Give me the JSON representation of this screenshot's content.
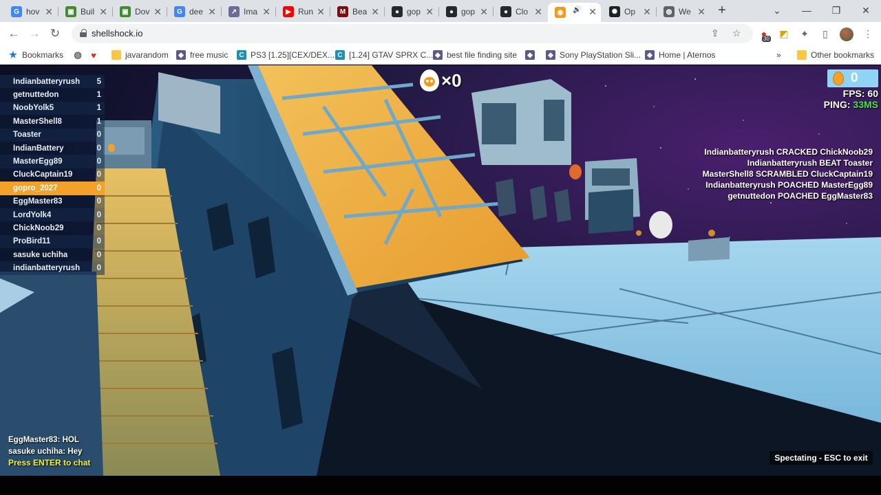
{
  "browser": {
    "tabs": [
      {
        "label": "hov",
        "icon": "google-icon",
        "color": "#ffffff"
      },
      {
        "label": "Buil",
        "icon": "minecraft-icon",
        "color": "#1a1a1a"
      },
      {
        "label": "Dov",
        "icon": "minecraft-icon",
        "color": "#1a1a1a"
      },
      {
        "label": "dee",
        "icon": "google-icon",
        "color": "#ffffff"
      },
      {
        "label": "Ima",
        "icon": "chart-icon",
        "color": "#ffffff"
      },
      {
        "label": "Run",
        "icon": "youtube-icon",
        "color": "#ff0000"
      },
      {
        "label": "Bea",
        "icon": "m-icon",
        "color": "#7a0d0d"
      },
      {
        "label": "gop",
        "icon": "github-icon",
        "color": "#ffffff"
      },
      {
        "label": "gop",
        "icon": "github-icon",
        "color": "#ffffff"
      },
      {
        "label": "Clo",
        "icon": "github-icon",
        "color": "#ffffff"
      },
      {
        "label": "",
        "icon": "shellshock-icon",
        "color": "#ffffff",
        "active": true
      },
      {
        "label": "Op",
        "icon": "openai-icon",
        "color": "#ffffff"
      },
      {
        "label": "We",
        "icon": "globe-icon",
        "color": "#ffffff"
      }
    ],
    "address": "shellshock.io",
    "extension_badge": "30",
    "bookmarks": [
      {
        "label": "Bookmarks",
        "icon": "star-icon"
      },
      {
        "label": "",
        "icon": "globe-icon"
      },
      {
        "label": "",
        "icon": "heart-icon"
      },
      {
        "label": "javarandom",
        "icon": "folder-icon"
      },
      {
        "label": "free music",
        "icon": "site-icon"
      },
      {
        "label": "PS3 [1.25][CEX/DEX...",
        "icon": "c-icon"
      },
      {
        "label": "[1.24] GTAV SPRX C...",
        "icon": "c-icon"
      },
      {
        "label": "best file finding site",
        "icon": "site-icon"
      },
      {
        "label": "",
        "icon": "site-icon"
      },
      {
        "label": "Sony PlayStation Sli...",
        "icon": "site-icon"
      },
      {
        "label": "Home | Aternos",
        "icon": "site-icon"
      }
    ],
    "other_bookmarks": "Other bookmarks",
    "more_bookmarks": "»"
  },
  "game": {
    "scoreboard": [
      {
        "name": "Indianbatteryrush",
        "score": "5"
      },
      {
        "name": "getnuttedon",
        "score": "1"
      },
      {
        "name": "NoobYolk5",
        "score": "1"
      },
      {
        "name": "MasterShell8",
        "score": "1"
      },
      {
        "name": "Toaster",
        "score": "0"
      },
      {
        "name": "IndianBattery",
        "score": "0"
      },
      {
        "name": "MasterEgg89",
        "score": "0"
      },
      {
        "name": "CluckCaptain19",
        "score": "0"
      },
      {
        "name": "gopro_2027",
        "score": "0",
        "me": true
      },
      {
        "name": "EggMaster83",
        "score": "0"
      },
      {
        "name": "LordYolk4",
        "score": "0"
      },
      {
        "name": "ChickNoob29",
        "score": "0"
      },
      {
        "name": "ProBird11",
        "score": "0"
      },
      {
        "name": "sasuke uchiha",
        "score": "0"
      },
      {
        "name": "indianbatteryrush",
        "score": "0"
      }
    ],
    "kills": "×0",
    "eggs": "0",
    "fps": "FPS: 60",
    "ping_label": "PING: ",
    "ping_value": "33MS",
    "killfeed": [
      "Indianbatteryrush CRACKED ChickNoob29",
      "Indianbatteryrush BEAT Toaster",
      "MasterShell8 SCRAMBLED CluckCaptain19",
      "Indianbatteryrush POACHED MasterEgg89",
      "getnuttedon POACHED EggMaster83"
    ],
    "chat": [
      "EggMaster83: HOL",
      "sasuke uchiha: Hey"
    ],
    "chat_hint": "Press ENTER to chat",
    "spectating": "Spectating - ESC to exit",
    "colors": {
      "me_row": "#f2a12b",
      "ping_good": "#47e24a",
      "chat_hint": "#f4f23a",
      "egg_counter_bg": "#8fd4f4"
    }
  }
}
